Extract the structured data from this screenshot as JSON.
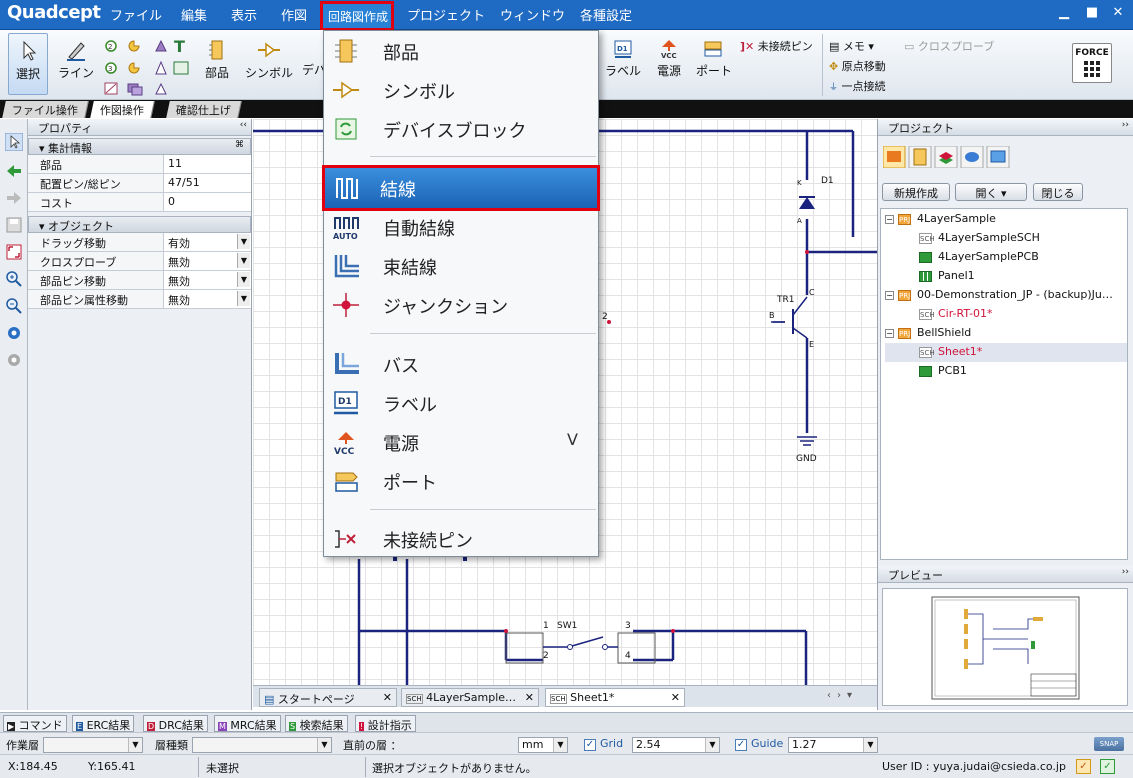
{
  "app": {
    "logo": "Quadcept"
  },
  "menubar": {
    "items": [
      "ファイル",
      "編集",
      "表示",
      "作図",
      "回路図作成",
      "プロジェクト",
      "ウィンドウ",
      "各種設定"
    ],
    "active": "回路図作成"
  },
  "ribbon": {
    "select": "選択",
    "line": "ライン",
    "part": "部品",
    "symbol": "シンボル",
    "device": "デバ",
    "label": "ラベル",
    "power": "電源",
    "port": "ポート",
    "unconnected_pin": "未接続ピン",
    "memo": "メモ",
    "origin_move": "原点移動",
    "single_point": "一点接続",
    "cross_probe": "クロスプローブ",
    "force": "FORCE"
  },
  "ribbon_tabs": [
    "ファイル操作",
    "作図操作",
    "確認仕上げ"
  ],
  "properties": {
    "title": "プロパティ",
    "section1": "集計情報",
    "rows1": [
      {
        "k": "部品",
        "v": "11"
      },
      {
        "k": "配置ピン/総ピン",
        "v": "47/51"
      },
      {
        "k": "コスト",
        "v": "0"
      }
    ],
    "section2": "オブジェクト",
    "rows2": [
      {
        "k": "ドラッグ移動",
        "v": "有効"
      },
      {
        "k": "クロスプローブ",
        "v": "無効"
      },
      {
        "k": "部品ピン移動",
        "v": "無効"
      },
      {
        "k": "部品ピン属性移動",
        "v": "無効"
      }
    ]
  },
  "dropdown": {
    "items": [
      "部品",
      "シンボル",
      "デバイスブロック",
      "結線",
      "自動結線",
      "束結線",
      "ジャンクション",
      "バス",
      "ラベル",
      "電源",
      "ポート",
      "未接続ピン"
    ],
    "power_accel": "V",
    "highlighted": "結線"
  },
  "schematic": {
    "d1": "D1",
    "tr1": "TR1",
    "gnd": "GND",
    "sw1": "SW1",
    "pin_b": "B",
    "pin_c": "C",
    "pin_e": "E",
    "pin_k": "K",
    "pin_a": "A",
    "n1": "1",
    "n2": "2",
    "n3": "3",
    "n4": "4",
    "n2b": "2"
  },
  "doc_tabs": [
    "スタートページ",
    "4LayerSample…",
    "Sheet1*"
  ],
  "project": {
    "title": "プロジェクト",
    "buttons": {
      "new": "新規作成",
      "open": "開く",
      "close": "閉じる"
    },
    "tree": [
      {
        "label": "4LayerSample",
        "level": 0,
        "kind": "prj"
      },
      {
        "label": "4LayerSampleSCH",
        "level": 1,
        "kind": "sch"
      },
      {
        "label": "4LayerSamplePCB",
        "level": 1,
        "kind": "pcb"
      },
      {
        "label": "Panel1",
        "level": 1,
        "kind": "panel"
      },
      {
        "label": "00-Demonstration_JP - (backup)Ju…",
        "level": 0,
        "kind": "prj"
      },
      {
        "label": "Cir-RT-01*",
        "level": 1,
        "kind": "sch",
        "red": true
      },
      {
        "label": "BellShield",
        "level": 0,
        "kind": "prj"
      },
      {
        "label": "Sheet1*",
        "level": 1,
        "kind": "sch",
        "red": true,
        "selected": true
      },
      {
        "label": "PCB1",
        "level": 1,
        "kind": "pcb"
      }
    ],
    "preview_title": "プレビュー"
  },
  "bottom_tabs": [
    "コマンド",
    "ERC結果",
    "DRC結果",
    "MRC結果",
    "検索結果",
    "設計指示"
  ],
  "layerbar": {
    "work_layer": "作業層",
    "layer_type": "層種類",
    "prev_layer": "直前の層 ：",
    "unit": "mm",
    "grid_label": "Grid",
    "grid": "2.54",
    "guide_label": "Guide",
    "guide": "1.27",
    "snap": "SNAP"
  },
  "status": {
    "x": "X:184.45",
    "y": "Y:165.41",
    "selection": "未選択",
    "message": "選択オブジェクトがありません。",
    "user": "User ID : yuya.judai@csieda.co.jp"
  },
  "colors": {
    "accent": "#1f6bc3",
    "highlight_border": "#e00010",
    "wire": "#1a237e"
  }
}
